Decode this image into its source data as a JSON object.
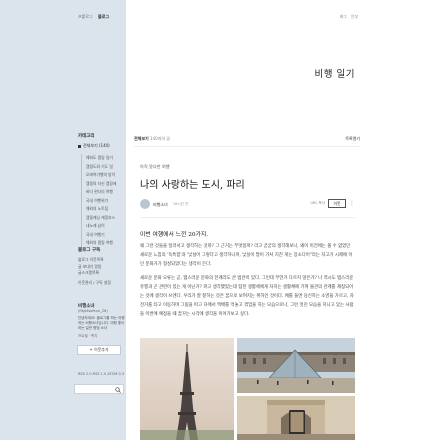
{
  "sidebar": {
    "top_links": [
      "프롤로그",
      "블로그"
    ],
    "category": {
      "title": "카테고리",
      "all_label": "전체보기 (140)",
      "items": [
        "해외도 캠핑 일기",
        "캠핑도와 기도 일",
        "오래여가행의 방이",
        "캠핑의 자신 캠핑에",
        "바다 왼다리 여행",
        "국내 여행위기",
        "해외의 노트팁",
        "캠핑캐닝 캐핑호스",
        "내노래 남이",
        "국내 여행기",
        "해외의 캠핑 여행"
      ]
    },
    "subscribe": {
      "title": "블로그 구독",
      "items": [
        "블로그 이웃목록",
        "글 보내기 알림",
        "글스크랩목록"
      ],
      "note": "이웃관리 / 구독 설정"
    },
    "profile": {
      "name": "비행소녀",
      "id": "(flightsofeun_26)",
      "desc": "안녕하세요! 블로그를 하는 여행하는 비행소녀입니다. 여행 좋아하는 일반 평범 소녀",
      "meta": "프로필 · 쪽지",
      "neighbor_btn": "+ 이웃추가"
    },
    "bottom": "RSS 2.0  RSS 1.0  ATOM 0.3"
  },
  "header": {
    "top_links": [
      "태그",
      "안부"
    ],
    "blog_title": "비행 일기"
  },
  "catbar": {
    "left": "전체보기",
    "count": "140개의 글",
    "right": "목록열기"
  },
  "post": {
    "category": "아직 못다한 여행",
    "title": "나의 사랑하는 도시, 파리",
    "author": "비행소녀",
    "date": "18시간 전",
    "actions": "URL 복사",
    "neighbor_btn": "이웃",
    "lead": "이번 여행에서 느낀 20가지.",
    "paragraphs": [
      "왜 그런 것들을 일러서고 생각하는 것까? 그 근거는 무엇일까? 라고 굳굳의 생각해보니, 왜이 이전에는 볼 수 없었던 새로운 느낌의 '독특함'과 '낯설어 그렇다고 생각하니까, 낯설이 많이 가서 지친 게는 장소다어\"라는 자고가 시제에 이던 문화거가 형성되었다는 생각이 든다.",
      "새로운 문화 오류는 곧, 탭스러운 문화의 한계라도 큰 법관이 있다. 그런데 무언가 다르지 않은가? 나 역시도 탭스러운 유행과 곤 관련이 있는 게 아닌가? 파고 생각했었는데 탑한 생활체에게 자지는 생활체에 기여 불관의 관계를 제정되어는 것에 생각이 쓰엔다. 우리가 잘 잘하는 것은 꿈으로 보여지는 위하인 것이다. 예를 들면 당신하는 소영을 가르고, 자전거를 타고 이동하며 그림을 따고 자에서 맥배를 먹놓고 꺾엄을 하는 모습으로나, 그런 멋진 모습을 지니고 있는 사람들 이번에 예정을 때 꿈꾸는 시각에 생각을 이어가보고 싶다."
    ]
  },
  "photos": [
    {
      "name": "eiffel-tower-photo",
      "colors": [
        "#e8ddd3",
        "#d8cabd"
      ]
    },
    {
      "name": "louvre-pyramid-photo",
      "colors": [
        "#c9d4dc",
        "#9aa7b0"
      ]
    },
    {
      "name": "arc-de-triomphe-photo",
      "colors": [
        "#d6c9b4",
        "#a99a84"
      ]
    }
  ]
}
